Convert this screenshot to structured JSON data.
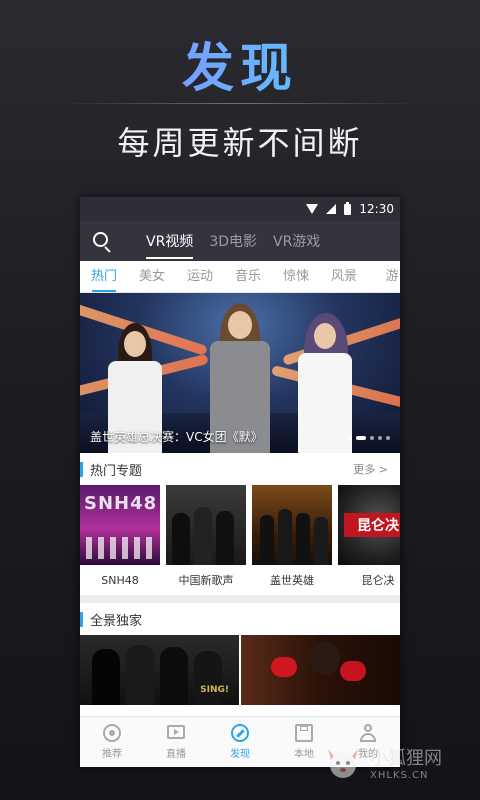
{
  "promo": {
    "title": "发现",
    "subtitle": "每周更新不间断"
  },
  "statusbar": {
    "time": "12:30"
  },
  "topnav": {
    "tabs": [
      {
        "label": "VR视频",
        "active": true
      },
      {
        "label": "3D电影",
        "active": false
      },
      {
        "label": "VR游戏",
        "active": false
      }
    ]
  },
  "categories": [
    {
      "label": "热门",
      "active": true
    },
    {
      "label": "美女",
      "active": false
    },
    {
      "label": "运动",
      "active": false
    },
    {
      "label": "音乐",
      "active": false
    },
    {
      "label": "惊悚",
      "active": false
    },
    {
      "label": "风景",
      "active": false
    },
    {
      "label": "游",
      "active": false
    }
  ],
  "banner": {
    "caption": "盖世英雄总决赛：VC女团《默》",
    "dots": 5,
    "active_dot": 1
  },
  "hot_topics": {
    "title": "热门专题",
    "more": "更多 >",
    "items": [
      {
        "label": "SNH48",
        "thumb_text": "SNH48"
      },
      {
        "label": "中国新歌声",
        "thumb_text": ""
      },
      {
        "label": "盖世英雄",
        "thumb_text": ""
      },
      {
        "label": "昆仑决",
        "thumb_text": "昆仑决"
      }
    ]
  },
  "panorama": {
    "title": "全景独家",
    "thumb_text": "SING!"
  },
  "bottomnav": [
    {
      "label": "推荐",
      "icon": "disc-icon",
      "active": false
    },
    {
      "label": "直播",
      "icon": "play-screen-icon",
      "active": false
    },
    {
      "label": "发现",
      "icon": "compass-icon",
      "active": true
    },
    {
      "label": "本地",
      "icon": "save-icon",
      "active": false
    },
    {
      "label": "我的",
      "icon": "user-icon",
      "active": false
    }
  ],
  "watermark": {
    "cn": "小狐狸网",
    "en": "XHLKS.CN"
  },
  "colors": {
    "accent": "#2ba5e6",
    "topbar": "#34353c",
    "statusbar": "#2e2f36"
  }
}
